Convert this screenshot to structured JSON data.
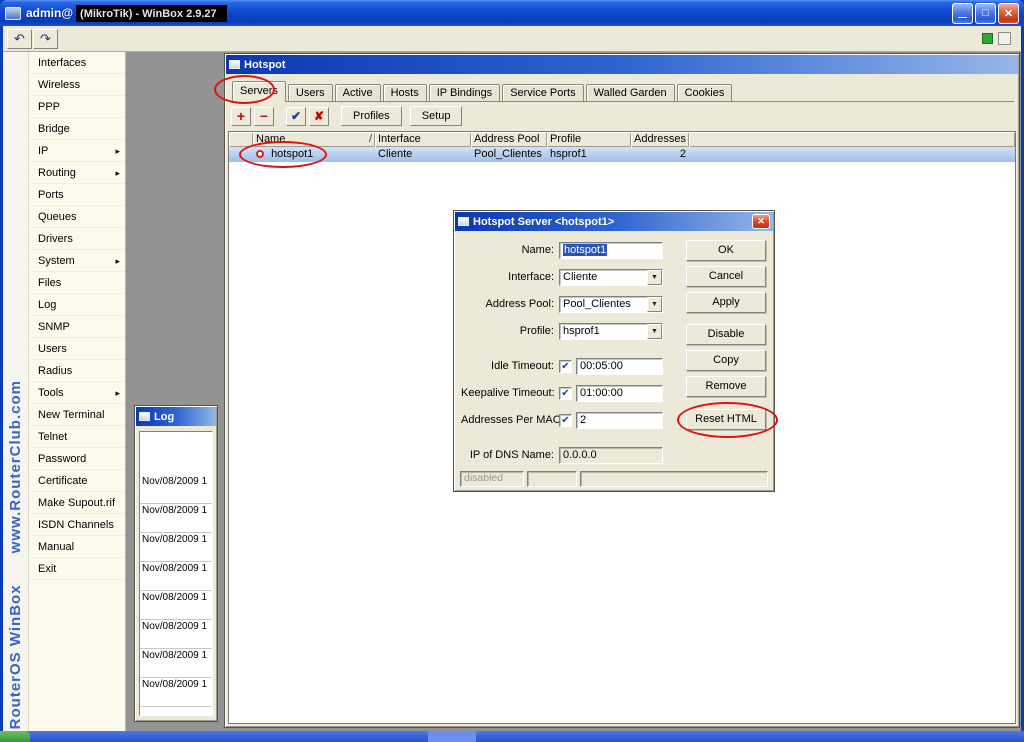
{
  "app": {
    "title_prefix": "admin@",
    "title_censored": "(MikroTik) - WinBox 2.9.27"
  },
  "icons": {
    "undo": "↶",
    "redo": "↷",
    "minimize": "—",
    "maximize": "□",
    "close": "✕",
    "add": "+",
    "remove": "−",
    "enable": "✔",
    "disable": "✘",
    "dropdown_arrow": "▼"
  },
  "watermark": {
    "line1": "RouterOS WinBox",
    "line2": "www.RouterClub.com"
  },
  "sidebar": {
    "items": [
      {
        "label": "Interfaces",
        "arrow_glyph": ""
      },
      {
        "label": "Wireless",
        "arrow_glyph": ""
      },
      {
        "label": "PPP",
        "arrow_glyph": ""
      },
      {
        "label": "Bridge",
        "arrow_glyph": ""
      },
      {
        "label": "IP",
        "arrow_glyph": "▸"
      },
      {
        "label": "Routing",
        "arrow_glyph": "▸"
      },
      {
        "label": "Ports",
        "arrow_glyph": ""
      },
      {
        "label": "Queues",
        "arrow_glyph": ""
      },
      {
        "label": "Drivers",
        "arrow_glyph": ""
      },
      {
        "label": "System",
        "arrow_glyph": "▸"
      },
      {
        "label": "Files",
        "arrow_glyph": ""
      },
      {
        "label": "Log",
        "arrow_glyph": ""
      },
      {
        "label": "SNMP",
        "arrow_glyph": ""
      },
      {
        "label": "Users",
        "arrow_glyph": ""
      },
      {
        "label": "Radius",
        "arrow_glyph": ""
      },
      {
        "label": "Tools",
        "arrow_glyph": "▸"
      },
      {
        "label": "New Terminal",
        "arrow_glyph": ""
      },
      {
        "label": "Telnet",
        "arrow_glyph": ""
      },
      {
        "label": "Password",
        "arrow_glyph": ""
      },
      {
        "label": "Certificate",
        "arrow_glyph": ""
      },
      {
        "label": "Make Supout.rif",
        "arrow_glyph": ""
      },
      {
        "label": "ISDN Channels",
        "arrow_glyph": ""
      },
      {
        "label": "Manual",
        "arrow_glyph": ""
      },
      {
        "label": "Exit",
        "arrow_glyph": ""
      }
    ]
  },
  "hotspot": {
    "title": "Hotspot",
    "tabs": [
      "Servers",
      "Users",
      "Active",
      "Hosts",
      "IP Bindings",
      "Service Ports",
      "Walled Garden",
      "Cookies"
    ],
    "buttons": {
      "profiles": "Profiles",
      "setup": "Setup"
    },
    "table": {
      "columns": [
        "Name",
        "Interface",
        "Address Pool",
        "Profile",
        "Addresses ..."
      ],
      "sort_indicator": "/",
      "row": {
        "name": "hotspot1",
        "interface": "Cliente",
        "address_pool": "Pool_Clientes",
        "profile": "hsprof1",
        "addresses": "2"
      }
    }
  },
  "dialog": {
    "title": "Hotspot Server <hotspot1>",
    "fields": {
      "name": {
        "label": "Name:",
        "value": "hotspot1"
      },
      "interface": {
        "label": "Interface:",
        "value": "Cliente"
      },
      "address_pool": {
        "label": "Address Pool:",
        "value": "Pool_Clientes"
      },
      "profile": {
        "label": "Profile:",
        "value": "hsprof1"
      },
      "idle_timeout": {
        "label": "Idle Timeout:",
        "value": "00:05:00",
        "check": "✔"
      },
      "keepalive_timeout": {
        "label": "Keepalive Timeout:",
        "value": "01:00:00",
        "check": "✔"
      },
      "addresses_per_mac": {
        "label": "Addresses Per MAC:",
        "value": "2",
        "check": "✔"
      },
      "ip_of_dns": {
        "label": "IP of DNS Name:",
        "value": "0.0.0.0"
      }
    },
    "buttons": {
      "ok": "OK",
      "cancel": "Cancel",
      "apply": "Apply",
      "disable": "Disable",
      "copy": "Copy",
      "remove": "Remove",
      "reset_html": "Reset HTML"
    },
    "status": "disabled"
  },
  "log": {
    "title": "Log",
    "rows": [
      "Nov/08/2009 1",
      "Nov/08/2009 1",
      "Nov/08/2009 1",
      "Nov/08/2009 1",
      "Nov/08/2009 1",
      "Nov/08/2009 1",
      "Nov/08/2009 1",
      "Nov/08/2009 1"
    ]
  }
}
